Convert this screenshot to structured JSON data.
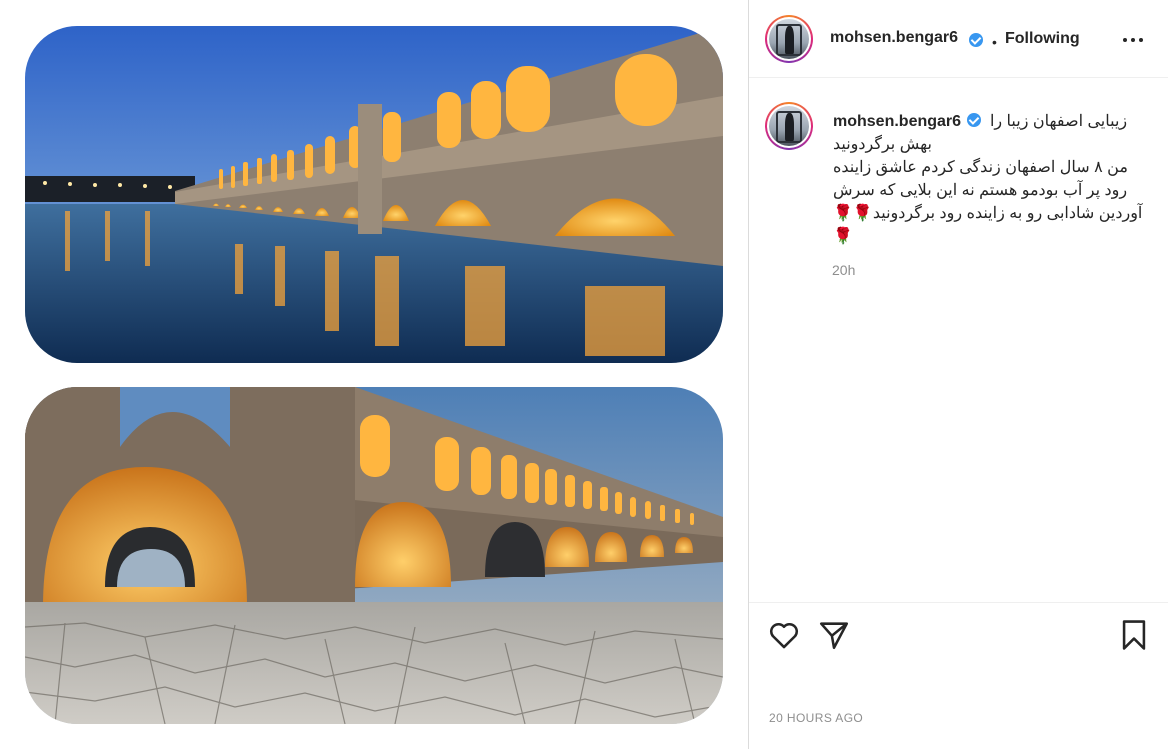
{
  "post": {
    "username": "mohsen.bengar6",
    "follow_status": "Following",
    "more_icon": "more-horizontal-icon",
    "caption_lines": [
      "زیبایی اصفهان زیبا را",
      "بهش برگردونید",
      "من ۸ سال اصفهان زندگی کردم عاشق زاینده",
      "رود پر آب بودمو هستم نه این بلایی که سرش",
      "آوردین شادابی رو به زاینده رود برگردونید🌹🌹",
      "🌹"
    ],
    "caption_time": "20h",
    "timestamp": "20 HOURS AGO"
  },
  "actions": {
    "like_icon": "heart-icon",
    "share_icon": "paper-plane-icon",
    "save_icon": "bookmark-icon"
  },
  "colors": {
    "verified": "#3897f0",
    "text": "#262626",
    "muted": "#8e8e8e",
    "divider": "#dbdbdb"
  }
}
